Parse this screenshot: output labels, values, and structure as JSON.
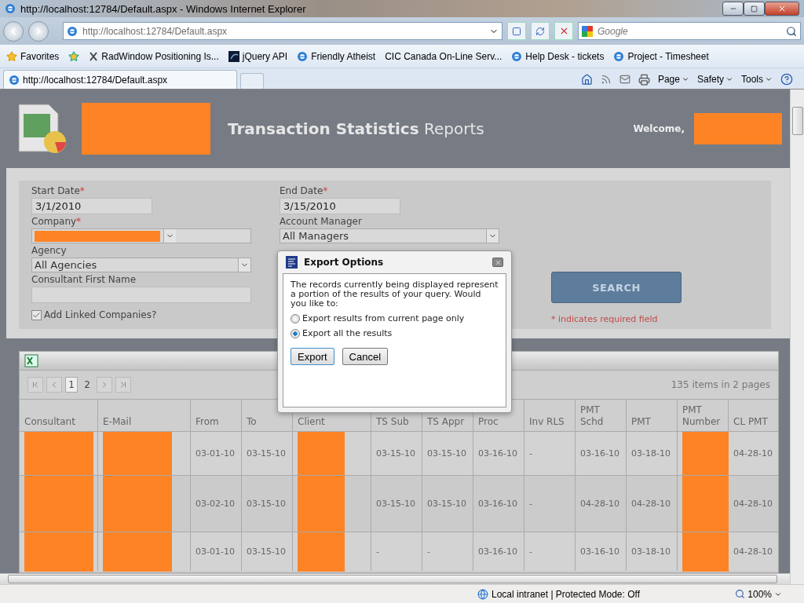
{
  "browser": {
    "title": "http://localhost:12784/Default.aspx - Windows Internet Explorer",
    "address": "http://localhost:12784/Default.aspx",
    "search_placeholder": "Google",
    "favorites_label": "Favorites",
    "favorites": [
      {
        "label": "RadWindow Positioning Is...",
        "kind": "rad"
      },
      {
        "label": "jQuery API",
        "kind": "jquery"
      },
      {
        "label": "Friendly Atheist",
        "kind": "ie"
      },
      {
        "label": "CIC Canada  On-Line Serv...",
        "kind": "none"
      },
      {
        "label": "Help Desk - tickets",
        "kind": "ie"
      },
      {
        "label": "Project - Timesheet",
        "kind": "ie"
      }
    ],
    "tab": "http://localhost:12784/Default.aspx",
    "commands": [
      "Page",
      "Safety",
      "Tools"
    ]
  },
  "page": {
    "title_bold": "Transaction Statistics",
    "title_light": "Reports",
    "welcome": "Welcome,"
  },
  "form": {
    "fields": [
      {
        "label": "Start Date",
        "required_mark": "*",
        "kind": "text",
        "value": "3/1/2010"
      },
      {
        "label": "End Date",
        "required_mark": "*",
        "kind": "text",
        "value": "3/15/2010"
      },
      {
        "label": "Company",
        "required_mark": "*",
        "kind": "redacted_select"
      },
      {
        "label": "Account Manager",
        "kind": "select",
        "value": "All Managers"
      },
      {
        "label": "Agency",
        "kind": "select",
        "value": "All Agencies"
      },
      {
        "label": "Consultant First Name",
        "kind": "text"
      }
    ],
    "checkbox": {
      "label": "Add Linked Companies?",
      "checked": true
    },
    "search_button": "SEARCH",
    "required_note": "* indicates required field"
  },
  "grid": {
    "pages": [
      {
        "label": "1",
        "selected": true
      },
      {
        "label": "2",
        "selected": false
      }
    ],
    "summary": "135 items in 2 pages",
    "columns": [
      {
        "label": "Consultant",
        "kind": "redacted"
      },
      {
        "label": "E-Mail",
        "kind": "redacted"
      },
      {
        "label": "From",
        "kind": "text"
      },
      {
        "label": "To",
        "kind": "text"
      },
      {
        "label": "Client",
        "kind": "redacted"
      },
      {
        "label": "TS Sub",
        "kind": "text"
      },
      {
        "label": "TS Appr",
        "kind": "text"
      },
      {
        "label": "Proc",
        "kind": "text"
      },
      {
        "label": "Inv RLS",
        "kind": "text"
      },
      {
        "label": "PMT Schd",
        "kind": "text"
      },
      {
        "label": "PMT",
        "kind": "text"
      },
      {
        "label": "PMT Number",
        "kind": "redacted"
      },
      {
        "label": "CL PMT",
        "kind": "text"
      }
    ],
    "rows": [
      {
        "cells": [
          "",
          "",
          "03-01-10",
          "03-15-10",
          "",
          "03-15-10",
          "03-15-10",
          "03-16-10",
          "-",
          "03-16-10",
          "03-18-10",
          "",
          "04-28-10"
        ]
      },
      {
        "cells": [
          "",
          "",
          "03-02-10",
          "03-15-10",
          "",
          "03-15-10",
          "03-15-10",
          "03-16-10",
          "-",
          "04-28-10",
          "04-28-10",
          "",
          "04-28-10"
        ]
      },
      {
        "cells": [
          "",
          "",
          "03-01-10",
          "03-15-10",
          "",
          "-",
          "-",
          "03-16-10",
          "-",
          "03-16-10",
          "03-18-10",
          "",
          "04-28-10"
        ]
      }
    ]
  },
  "dialog": {
    "title": "Export Options",
    "message": "The records currently being displayed represent a portion of the results of your query. Would you like to:",
    "options": [
      {
        "label": "Export results from current page only",
        "selected": false
      },
      {
        "label": "Export all the results",
        "selected": true
      }
    ],
    "buttons": [
      "Export",
      "Cancel"
    ]
  },
  "status_bar": {
    "zone": "Local intranet | Protected Mode: Off",
    "zoom": "100%"
  }
}
